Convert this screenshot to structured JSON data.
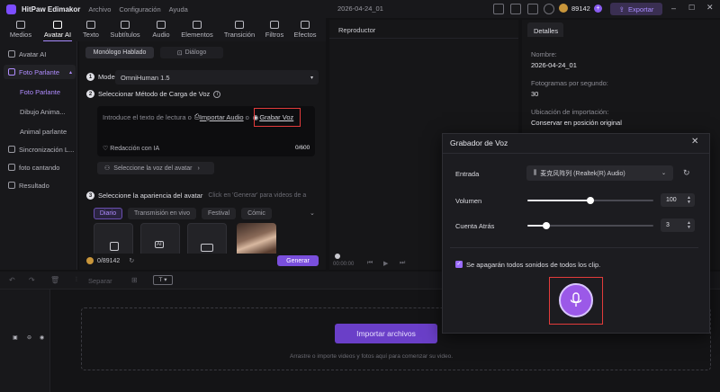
{
  "titlebar": {
    "app_name": "HitPaw Edimakor",
    "menu": [
      "Archivo",
      "Configuración",
      "Ayuda"
    ],
    "project_title": "2026-04-24_01",
    "credits": "89142",
    "export_label": "Exportar"
  },
  "toolbar": {
    "tabs": [
      {
        "label": "Medios",
        "icon": "media-icon"
      },
      {
        "label": "Avatar AI",
        "icon": "avatar-icon"
      },
      {
        "label": "Texto",
        "icon": "text-icon"
      },
      {
        "label": "Subtítulos",
        "icon": "subtitles-icon"
      },
      {
        "label": "Audio",
        "icon": "audio-icon"
      },
      {
        "label": "Elementos",
        "icon": "elements-icon"
      },
      {
        "label": "Transición",
        "icon": "transition-icon"
      },
      {
        "label": "Filtros",
        "icon": "filters-icon"
      },
      {
        "label": "Efectos",
        "icon": "effects-icon"
      }
    ],
    "active": "Avatar AI"
  },
  "sidebar": {
    "items": [
      {
        "label": "Avatar AI"
      },
      {
        "label": "Foto Parlante"
      },
      {
        "label": "Foto Parlante"
      },
      {
        "label": "Dibujo Anima..."
      },
      {
        "label": "Animal parlante"
      },
      {
        "label": "Sincronización L..."
      },
      {
        "label": "foto cantando"
      },
      {
        "label": "Resultado"
      }
    ]
  },
  "panel": {
    "mode_tabs": [
      "Monólogo Hablado",
      "Diálogo"
    ],
    "step1_label": "Modelo",
    "model_value": "OmniHuman 1.5",
    "step2_label": "Seleccionar Método de Carga de Voz",
    "text_placeholder": "Introduce el texto de lectura o",
    "import_audio": "Importar Audio",
    "record_voice": "Grabar Voz",
    "char_count": "0/600",
    "ai_writing": "Redacción con IA",
    "select_voice": "Seleccione la voz del avatar",
    "step3_label": "Seleccione la apariencia del avatar",
    "step3_hint": "Click en 'Generar' para videos de a",
    "styles": [
      "Diario",
      "Transmisión en vivo",
      "Festival",
      "Cómic"
    ],
    "footer_credits": "0/89142",
    "generate_label": "Generar"
  },
  "player": {
    "title": "Reproductor",
    "timecode": "00:00:00"
  },
  "details": {
    "tab": "Detalles",
    "name_label": "Nombre:",
    "name_value": "2026-04-24_01",
    "fps_label": "Fotogramas por segundo:",
    "fps_value": "30",
    "location_label": "Ubicación de importación:",
    "location_value": "Conservar en posición original"
  },
  "timeline": {
    "split_label": "Separar",
    "import_label": "Importar archivos",
    "hint": "Arrastre o importe videos y fotos aquí para comenzar su video."
  },
  "recorder": {
    "title": "Grabador de Voz",
    "input_label": "Entrada",
    "input_device": "麦克风阵列 (Realtek(R) Audio)",
    "volume_label": "Volumen",
    "volume_value": "100",
    "volume_level": 1.0,
    "countdown_label": "Cuenta Atrás",
    "countdown_value": "3",
    "countdown_level": 0.3,
    "mute_label": "Se apagarán todos sonidos de todos los clip."
  }
}
